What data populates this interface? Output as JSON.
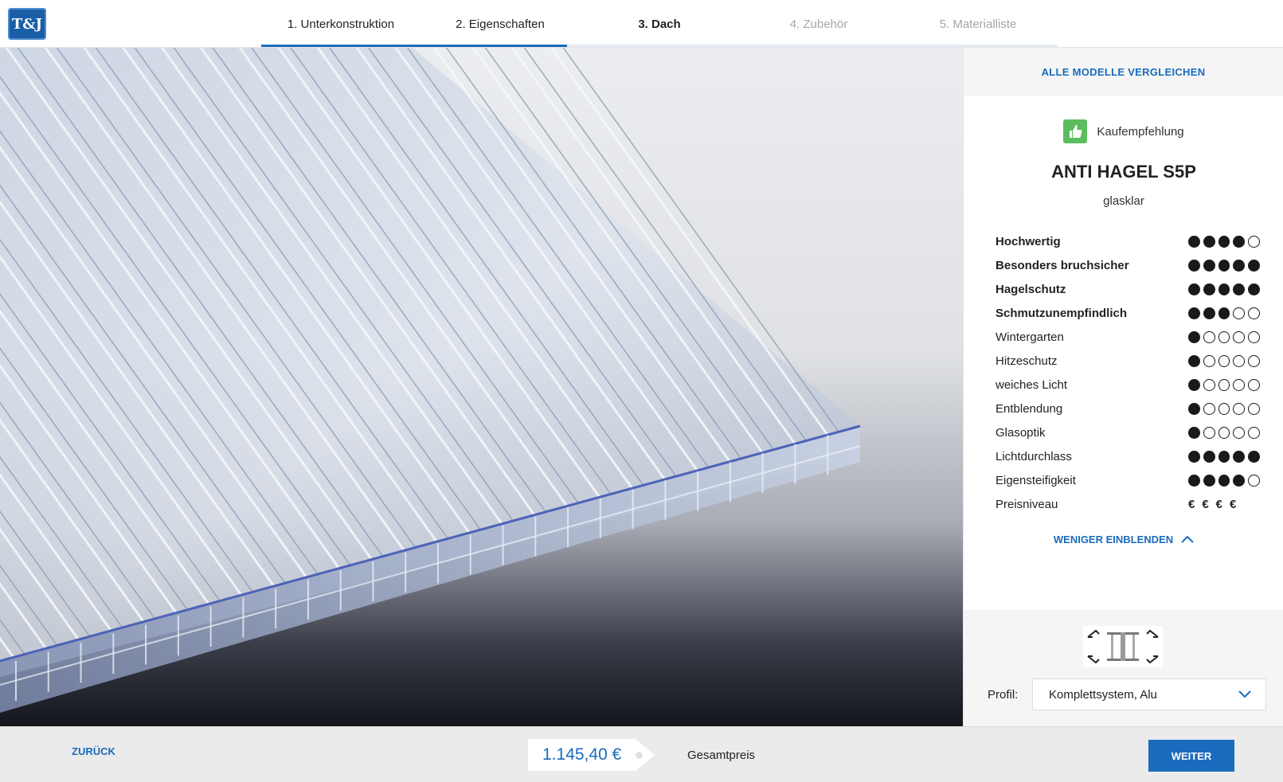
{
  "header": {
    "logo_text": "T&J",
    "steps": [
      {
        "label": "1. Unterkonstruktion"
      },
      {
        "label": "2. Eigenschaften"
      },
      {
        "label": "3. Dach"
      },
      {
        "label": "4. Zubehör"
      },
      {
        "label": "5. Materialliste"
      }
    ],
    "progress_steps_completed": 3,
    "progress_total_steps": 5
  },
  "side": {
    "compare_label": "ALLE MODELLE VERGLEICHEN",
    "recommendation_label": "Kaufempfehlung",
    "product_name": "ANTI HAGEL S5P",
    "product_variant": "glasklar",
    "properties": [
      {
        "label": "Hochwertig",
        "rating": 4,
        "max": 5,
        "bold": true
      },
      {
        "label": "Besonders bruchsicher",
        "rating": 5,
        "max": 5,
        "bold": true
      },
      {
        "label": "Hagelschutz",
        "rating": 5,
        "max": 5,
        "bold": true
      },
      {
        "label": "Schmutzunempfindlich",
        "rating": 3,
        "max": 5,
        "bold": true
      },
      {
        "label": "Wintergarten",
        "rating": 1,
        "max": 5,
        "bold": false
      },
      {
        "label": "Hitzeschutz",
        "rating": 1,
        "max": 5,
        "bold": false
      },
      {
        "label": "weiches Licht",
        "rating": 1,
        "max": 5,
        "bold": false
      },
      {
        "label": "Entblendung",
        "rating": 1,
        "max": 5,
        "bold": false
      },
      {
        "label": "Glasoptik",
        "rating": 1,
        "max": 5,
        "bold": false
      },
      {
        "label": "Lichtdurchlass",
        "rating": 5,
        "max": 5,
        "bold": false
      },
      {
        "label": "Eigensteifigkeit",
        "rating": 4,
        "max": 5,
        "bold": false
      }
    ],
    "price_level": {
      "label": "Preisniveau",
      "value": "€€€€"
    },
    "less_label": "WENIGER EINBLENDEN",
    "profile": {
      "label": "Profil:",
      "selected": "Komplettsystem, Alu"
    }
  },
  "footer": {
    "back_label": "ZURÜCK",
    "price": "1.145,40 €",
    "total_label": "Gesamtpreis",
    "next_label": "WEITER"
  },
  "colors": {
    "accent": "#1a6bbd",
    "recommendation": "#5cbd5f"
  },
  "icons": {
    "recommendation": "thumbs-up-icon",
    "less": "chevron-up-icon",
    "select": "chevron-down-icon"
  }
}
